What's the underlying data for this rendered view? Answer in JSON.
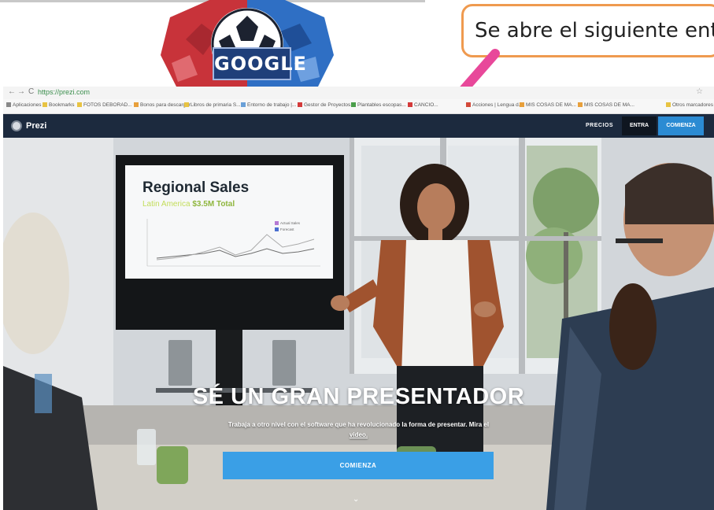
{
  "google_logo_text": "GOOGLE",
  "callout": {
    "text": "Se abre el siguiente entor"
  },
  "browser": {
    "nav": {
      "back": "←",
      "forward": "→",
      "reload": "C"
    },
    "url": "https://prezi.com",
    "star": "☆",
    "bookmarks": [
      "Aplicaciones",
      "Bookmarks",
      "FOTOS DEBORAD...",
      "Bonos para descargar",
      "Libros de primaria S...",
      "Entorno de trabajo |...",
      "Gestor de Proyectos...",
      "Plantables escopas...",
      "CANCIO...",
      "Acciones | Lengua d...",
      "MIS COSAS DE MA...",
      "MIS COSAS DE MA...",
      "Otros marcadores"
    ]
  },
  "prezi": {
    "brand": "Prezi",
    "nav": {
      "precios": "PRECIOS",
      "entra": "ENTRA",
      "comienza": "COMIENZA"
    }
  },
  "slide": {
    "title": "Regional Sales",
    "subtitle_region": "Latin America",
    "subtitle_total": "$3.5M Total",
    "legend": [
      "Actual Sales",
      "Forecast"
    ]
  },
  "hero": {
    "headline": "SÉ UN GRAN PRESENTADOR",
    "subline": "Trabaja a otro nivel con el software que ha revolucionado la forma de presentar. Mira el",
    "subline_link": "video.",
    "cta": "COMIENZA",
    "scroll_icon": "⌄"
  },
  "colors": {
    "nav_bg": "#1c2a3e",
    "accent": "#3a9fe6",
    "callout_border": "#ef9a4f",
    "arrow": "#e8489a"
  }
}
